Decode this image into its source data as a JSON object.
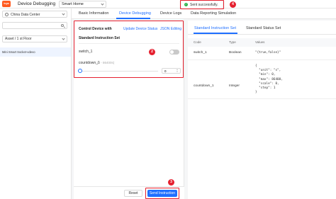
{
  "header": {
    "logo_text": "tuya",
    "title": "Device Debugging",
    "project": "Smart Home"
  },
  "sidebar": {
    "region": "China Data Center",
    "search_value": "",
    "space": "Asset / 1 st Floor",
    "device": "Mini Smart Socket-vdevo"
  },
  "tabs": [
    {
      "label": "Basic Information"
    },
    {
      "label": "Device Debugging"
    },
    {
      "label": "Device Logs"
    },
    {
      "label": "Data Reporting Simulation"
    }
  ],
  "debug": {
    "control_label": "Control Device with",
    "control_option_1": "Update Device Status",
    "control_option_2": "JSON Editing",
    "standard_set_label": "Standard Instruction Set",
    "switch_label": "switch_1",
    "switch_on": false,
    "countdown_label": "countdown_1",
    "countdown_range": "(0 - 86400s)",
    "countdown_value": "0",
    "reset_label": "Reset",
    "send_label": "Send Instruction"
  },
  "toast": {
    "text": "Sent successfully."
  },
  "badges": [
    "2",
    "3",
    "4"
  ],
  "right_panel": {
    "tab_standard": "Standard Instruction Set",
    "tab_status": "Standard Status Set",
    "columns": [
      "Code",
      "Type",
      "Values"
    ],
    "rows": [
      {
        "code": "switch_1",
        "type": "Boolean",
        "values": "\"{true,false}\""
      },
      {
        "code": "countdown_1",
        "type": "Integer",
        "values": "{\n  \"unit\": \"s\",\n  \"min\": 0,\n  \"max\": 86400,\n  \"scale\": 0,\n  \"step\": 1\n}"
      }
    ]
  },
  "colors": {
    "accent": "#1f6fff",
    "highlight": "#e5202f",
    "success": "#2bb24c"
  }
}
